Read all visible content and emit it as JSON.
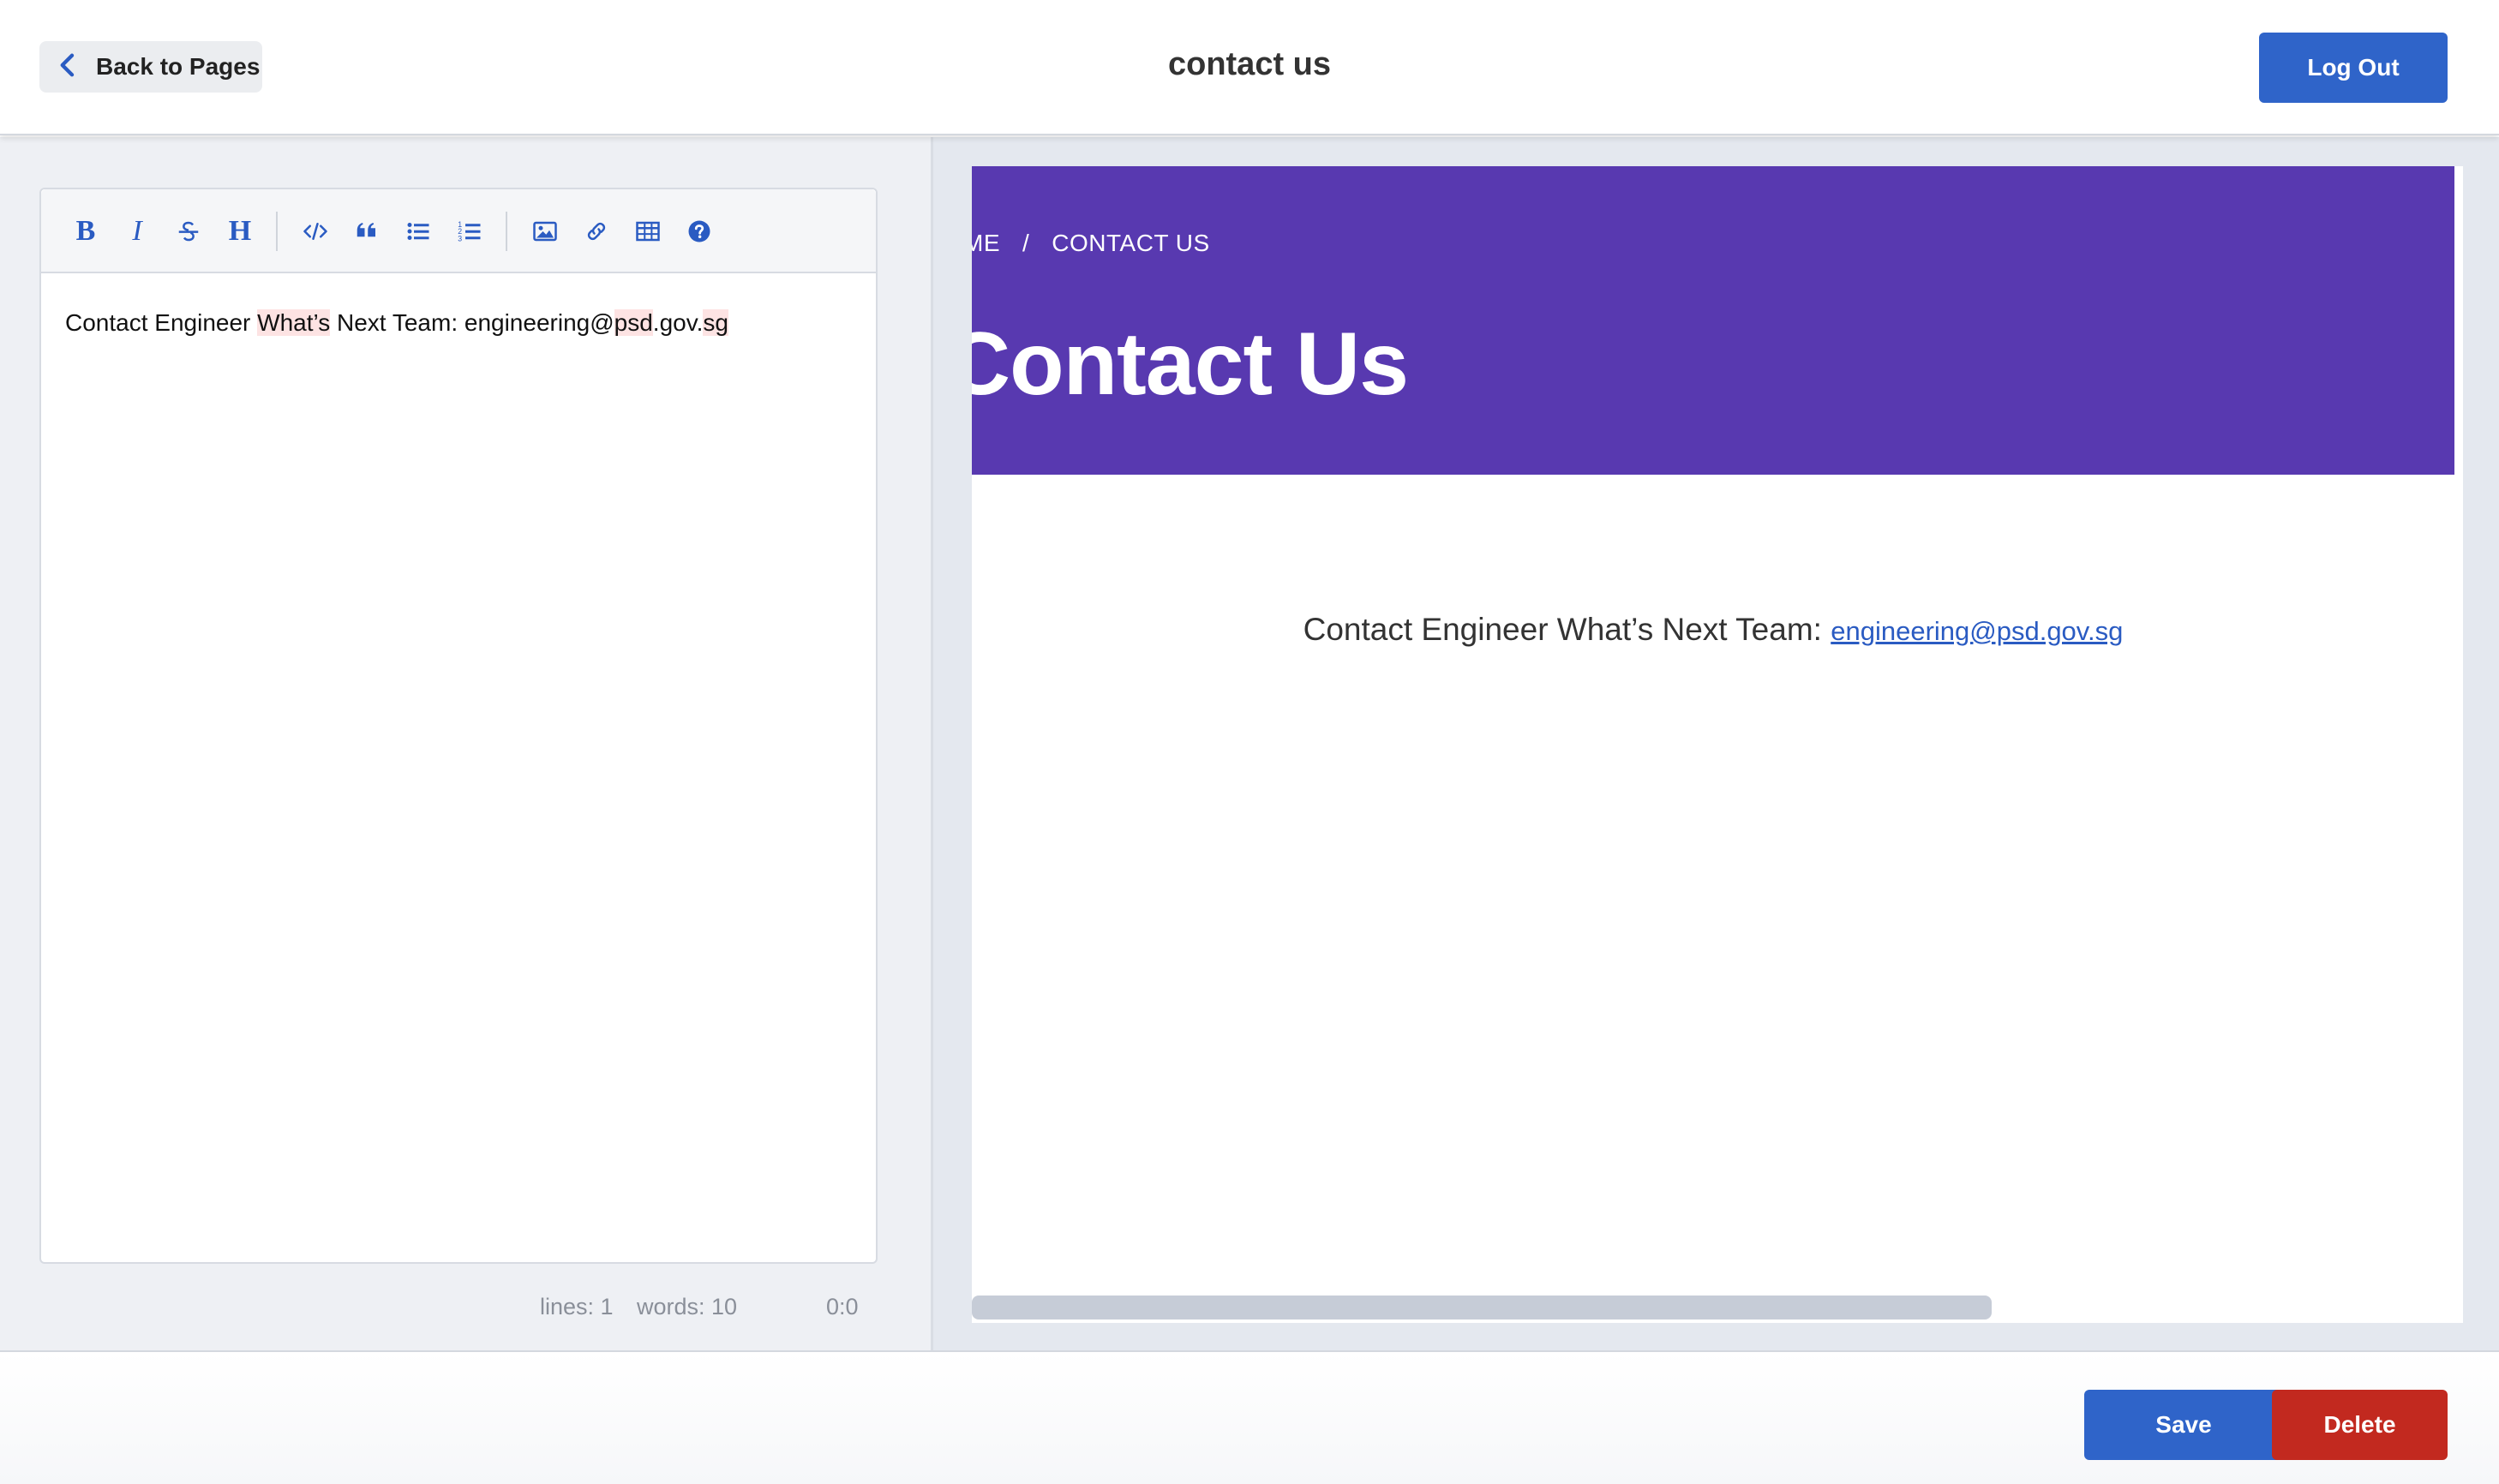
{
  "header": {
    "back_label": "Back to Pages",
    "page_title": "contact us",
    "logout_label": "Log Out"
  },
  "toolbar": {
    "bold_label": "B",
    "italic_label": "I",
    "heading_label": "H",
    "icons": [
      "bold-icon",
      "italic-icon",
      "strikethrough-icon",
      "heading-icon",
      "code-icon",
      "quote-icon",
      "unordered-list-icon",
      "ordered-list-icon",
      "image-icon",
      "link-icon",
      "table-icon",
      "help-icon"
    ]
  },
  "editor": {
    "text_before": "Contact Engineer ",
    "text_highlight_1": "What’s",
    "text_mid": " Next Team: engineering@",
    "text_highlight_2": "psd",
    "text_mid_2": ".gov.",
    "text_highlight_3": "sg"
  },
  "status": {
    "lines": "lines: 1",
    "words": "words: 10",
    "cursor": "0:0"
  },
  "preview": {
    "breadcrumb_home": "ME",
    "breadcrumb_separator": "/",
    "breadcrumb_current": "CONTACT US",
    "hero_title": "Contact Us",
    "body_text": "Contact Engineer What’s Next Team: ",
    "email_link": "engineering@psd.gov.sg"
  },
  "footer": {
    "save_label": "Save",
    "delete_label": "Delete"
  },
  "colors": {
    "primary_blue": "#2f64c9",
    "danger_red": "#c2291f",
    "hero_purple": "#5839b0",
    "highlight_pink": "#fde3e3"
  }
}
